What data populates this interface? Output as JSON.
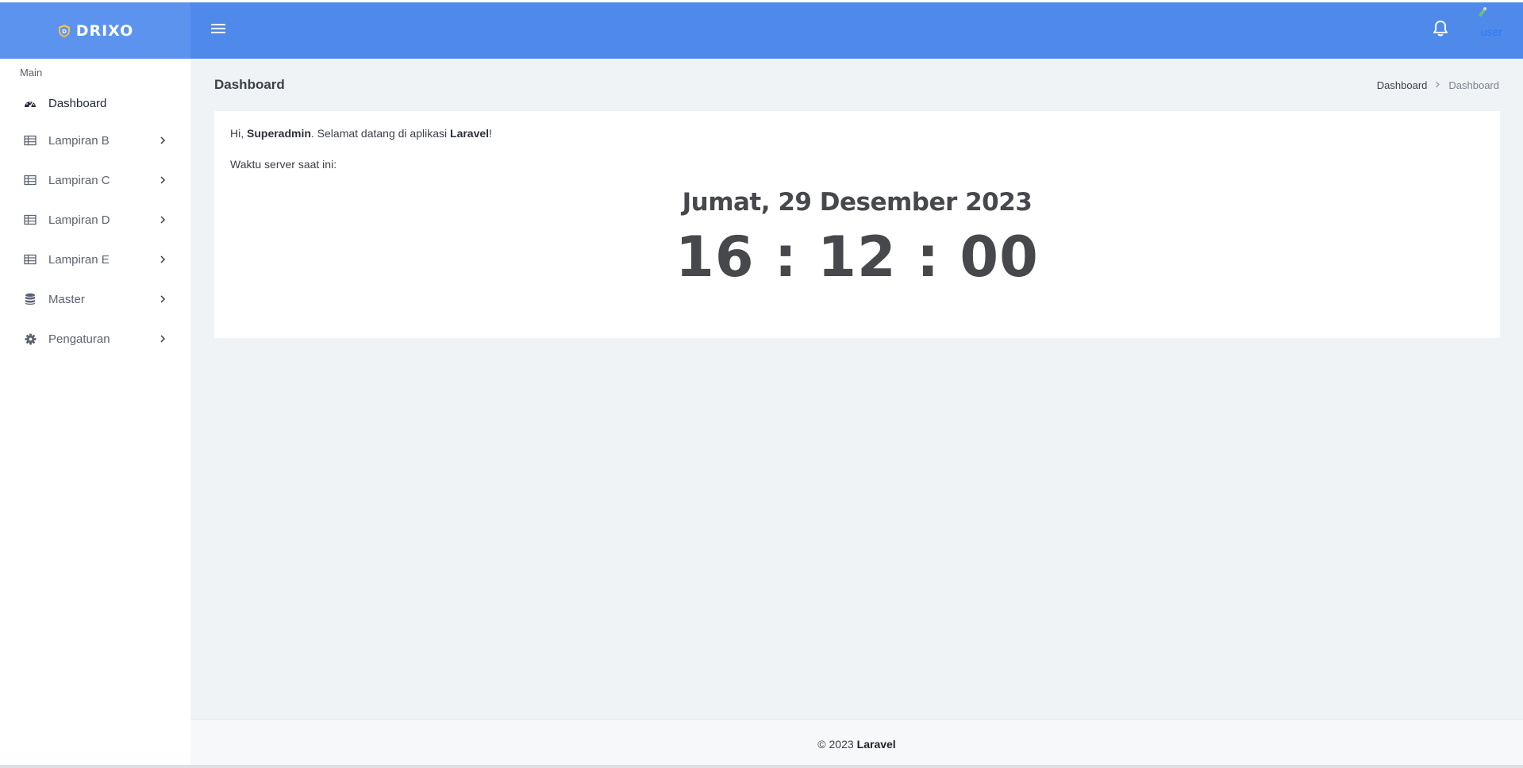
{
  "brand": {
    "name": "DRIXO"
  },
  "colors": {
    "topbar": "#4f8aea",
    "brand_bg": "#5b93ee",
    "accent": "#2d7bf0",
    "main_bg": "#f0f3f6"
  },
  "header": {
    "user_label": "user",
    "icons": [
      "menu-icon",
      "bell-icon",
      "avatar-icon"
    ]
  },
  "sidebar": {
    "section": "Main",
    "items": [
      {
        "label": "Dashboard",
        "icon": "dashboard-icon",
        "active": true
      },
      {
        "label": "Lampiran B",
        "icon": "table-icon"
      },
      {
        "label": "Lampiran C",
        "icon": "table-icon"
      },
      {
        "label": "Lampiran D",
        "icon": "table-icon"
      },
      {
        "label": "Lampiran E",
        "icon": "table-icon"
      },
      {
        "label": "Master",
        "icon": "database-icon"
      },
      {
        "label": "Pengaturan",
        "icon": "gear-icon"
      }
    ]
  },
  "page": {
    "title": "Dashboard",
    "breadcrumb": {
      "link": "Dashboard",
      "current": "Dashboard"
    }
  },
  "welcome": {
    "prefix": "Hi, ",
    "user": "Superadmin",
    "middle": ". Selamat datang di aplikasi ",
    "app": "Laravel",
    "suffix": "!",
    "server_time_label": "Waktu server saat ini:",
    "date": "Jumat, 29 Desember 2023",
    "time": "16 : 12 : 00"
  },
  "footer": {
    "copyright": "© 2023",
    "app": "Laravel"
  }
}
